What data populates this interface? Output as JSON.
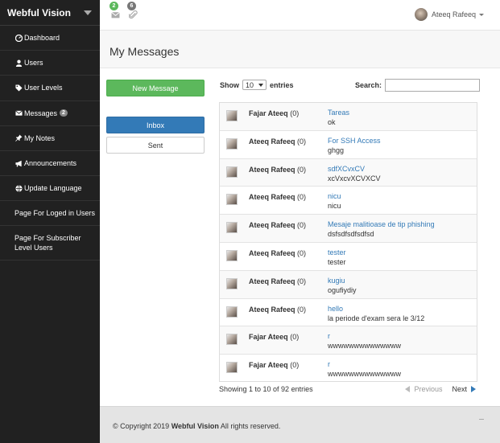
{
  "sidebar": {
    "brand": "Webful Vision",
    "items": [
      {
        "label": "Dashboard",
        "icon": "dashboard-icon"
      },
      {
        "label": "Users",
        "icon": "user-icon"
      },
      {
        "label": "User Levels",
        "icon": "tag-icon"
      },
      {
        "label": "Messages",
        "icon": "envelope-icon",
        "badge": "2"
      },
      {
        "label": "My Notes",
        "icon": "pin-icon"
      },
      {
        "label": "Announcements",
        "icon": "bullhorn-icon"
      },
      {
        "label": "Update Language",
        "icon": "globe-icon"
      },
      {
        "label": "Page For Loged in Users"
      },
      {
        "label": "Page For Subscriber Level Users"
      }
    ]
  },
  "topbar": {
    "messages_badge": "2",
    "attachments_badge": "6",
    "messages_badge_color": "#5cb85c",
    "attachments_badge_color": "#777777",
    "user_name": "Ateeq Rafeeq"
  },
  "page": {
    "title": "My Messages"
  },
  "actions": {
    "new_message": "New Message",
    "inbox": "Inbox",
    "sent": "Sent"
  },
  "table": {
    "show_label": "Show",
    "page_size": "10",
    "entries_label": "entries",
    "search_label": "Search:",
    "search_value": "",
    "rows": [
      {
        "sender": "Fajar Ateeq",
        "count": "(0)",
        "subject": "Tareas",
        "body": "ok"
      },
      {
        "sender": "Ateeq Rafeeq",
        "count": "(0)",
        "subject": "For SSH Access",
        "body": "ghgg"
      },
      {
        "sender": "Ateeq Rafeeq",
        "count": "(0)",
        "subject": "sdfXCvxCV",
        "body": "xcVxcvXCVXCV"
      },
      {
        "sender": "Ateeq Rafeeq",
        "count": "(0)",
        "subject": "nicu",
        "body": "nicu"
      },
      {
        "sender": "Ateeq Rafeeq",
        "count": "(0)",
        "subject": "Mesaje malitioase de tip phishing",
        "body": "dsfsdfsdfsdfsd"
      },
      {
        "sender": "Ateeq Rafeeq",
        "count": "(0)",
        "subject": "tester",
        "body": "tester"
      },
      {
        "sender": "Ateeq Rafeeq",
        "count": "(0)",
        "subject": "kugiu",
        "body": "ogufiydiy"
      },
      {
        "sender": "Ateeq Rafeeq",
        "count": "(0)",
        "subject": "hello",
        "body": "la periode d'exam sera le 3/12"
      },
      {
        "sender": "Fajar Ateeq",
        "count": "(0)",
        "subject": "r",
        "body": "wwwwwwwwwwwwww"
      },
      {
        "sender": "Fajar Ateeq",
        "count": "(0)",
        "subject": "r",
        "body": "wwwwwwwwwwwwww"
      }
    ],
    "info": "Showing 1 to 10 of 92 entries",
    "previous": "Previous",
    "next": "Next"
  },
  "footer": {
    "prefix": "© Copyright 2019",
    "brand": "Webful Vision",
    "suffix": "All rights reserved."
  }
}
